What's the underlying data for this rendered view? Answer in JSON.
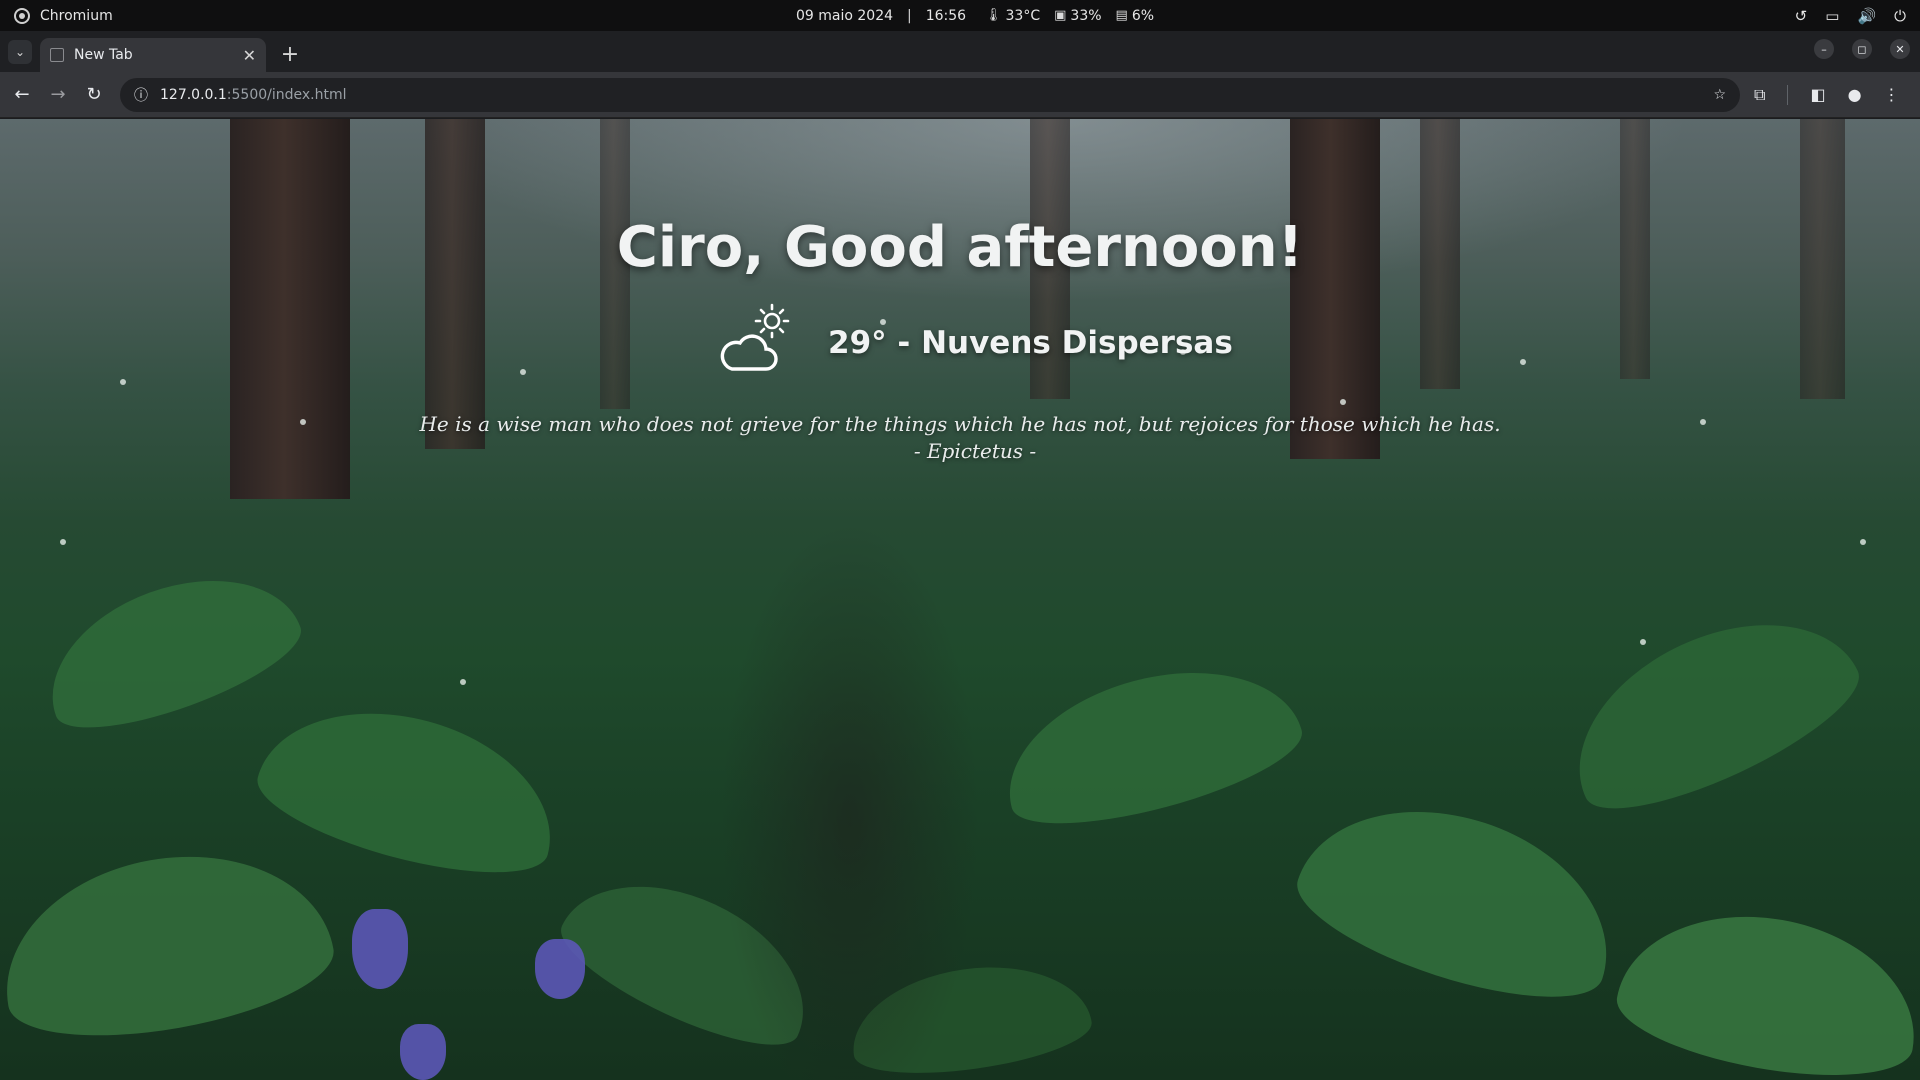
{
  "os_bar": {
    "app_name": "Chromium",
    "date": "09 maio 2024",
    "separator": "|",
    "time": "16:56",
    "cpu_temp": "33°C",
    "cpu_usage": "33%",
    "disk_usage": "6%"
  },
  "browser": {
    "tab_title": "New Tab",
    "url_host": "127.0.0.1",
    "url_path": ":5500/index.html"
  },
  "page": {
    "greeting": "Ciro, Good afternoon!",
    "weather_text": "29° - Nuvens Dispersas",
    "quote_text": "He is a wise man who does not grieve for the things which he has not, but rejoices for those which he has.",
    "quote_author": "- Epictetus -"
  },
  "icons": {
    "weather": "cloud-sun-icon"
  }
}
